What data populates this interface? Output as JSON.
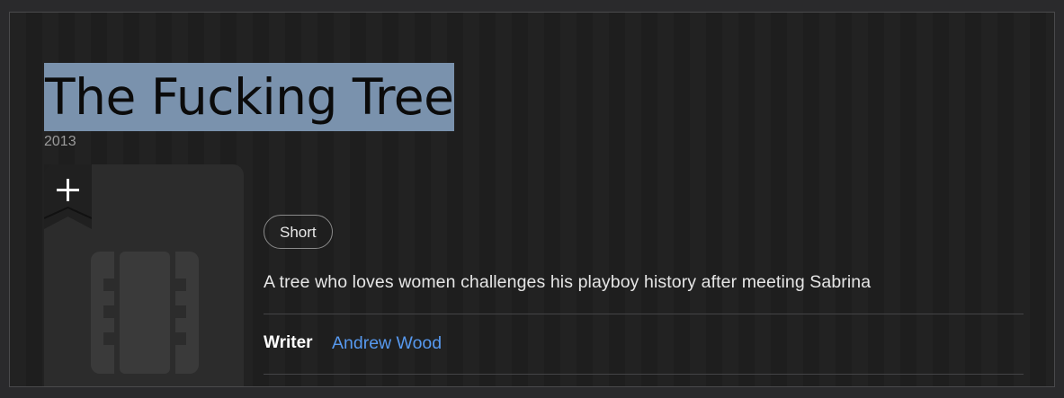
{
  "title": "The Fucking Tree",
  "year": "2013",
  "watchlist": {
    "icon": "plus-icon"
  },
  "poster": {
    "placeholder_icon": "film-icon"
  },
  "genres": [
    "Short"
  ],
  "plot": "A tree who loves women challenges his playboy history after meeting Sabrina",
  "credits": {
    "writer_label": "Writer",
    "writer_name": "Andrew Wood"
  },
  "colors": {
    "background": "#1f1f1f",
    "selection": "#7a92ad",
    "link": "#5799ef",
    "chip_border": "#8a8a8a"
  }
}
